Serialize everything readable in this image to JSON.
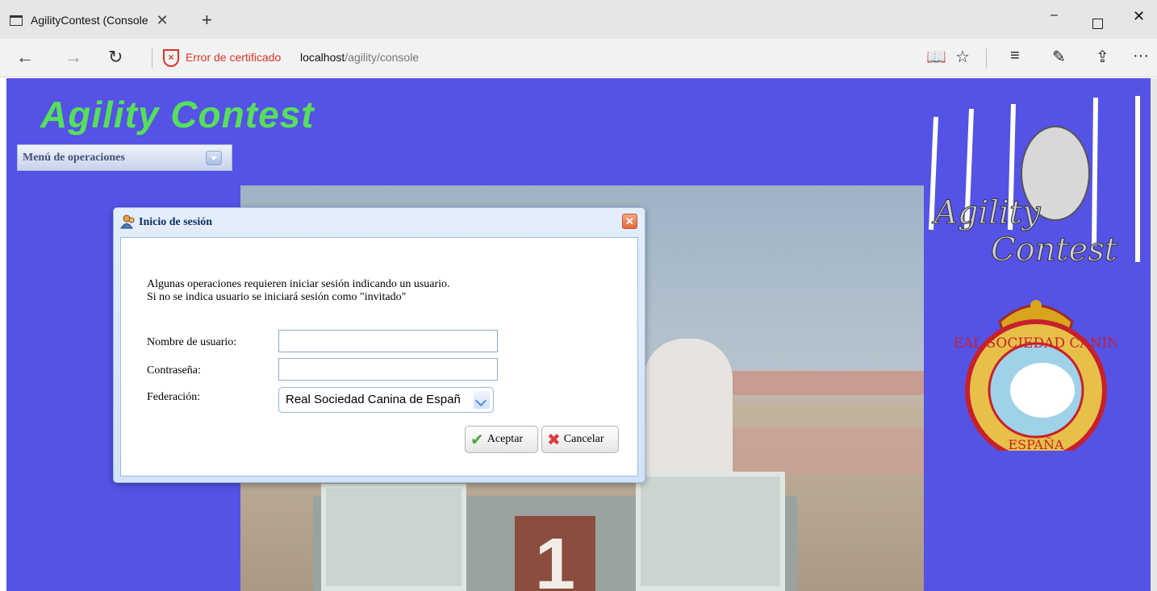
{
  "browser": {
    "tab_title": "AgilityContest (Console",
    "tab_close": "✕",
    "new_tab": "+",
    "window_minimize": "–",
    "window_close": "✕",
    "back": "←",
    "forward": "→",
    "reload": "↻",
    "cert_warning": "Error de certificado",
    "url_host": "localhost",
    "url_path": "/agility/console",
    "tools": {
      "reading_view": "📖",
      "favorite": "☆",
      "hub": "≡",
      "notes": "✎",
      "share": "⇪",
      "more": "···"
    }
  },
  "page": {
    "app_title": "Agility Contest",
    "menu_label": "Menú de operaciones",
    "photo_number": "1"
  },
  "login_dialog": {
    "title": "Inicio de sesión",
    "close_glyph": "✕",
    "message_line1": "Algunas operaciones requieren iniciar sesión indicando un usuario.",
    "message_line2": "Si no se indica usuario se iniciará sesión como \"invitado\"",
    "username_label": "Nombre de usuario:",
    "username_value": "",
    "password_label": "Contraseña:",
    "password_value": "",
    "federation_label": "Federación:",
    "federation_selected": "Real Sociedad Canina de Españ",
    "accept_label": "Aceptar",
    "accept_icon": "✔",
    "cancel_label": "Cancelar",
    "cancel_icon": "✖"
  },
  "logos": {
    "agility_text_1": "Agility",
    "agility_text_2": "Contest",
    "rsce_text": "REAL SOCIEDAD CANINA",
    "rsce_bottom": "ESPAÑA"
  },
  "colors": {
    "page_background": "#5552e6",
    "title_green": "#56e05a",
    "cert_red": "#d9342b"
  }
}
